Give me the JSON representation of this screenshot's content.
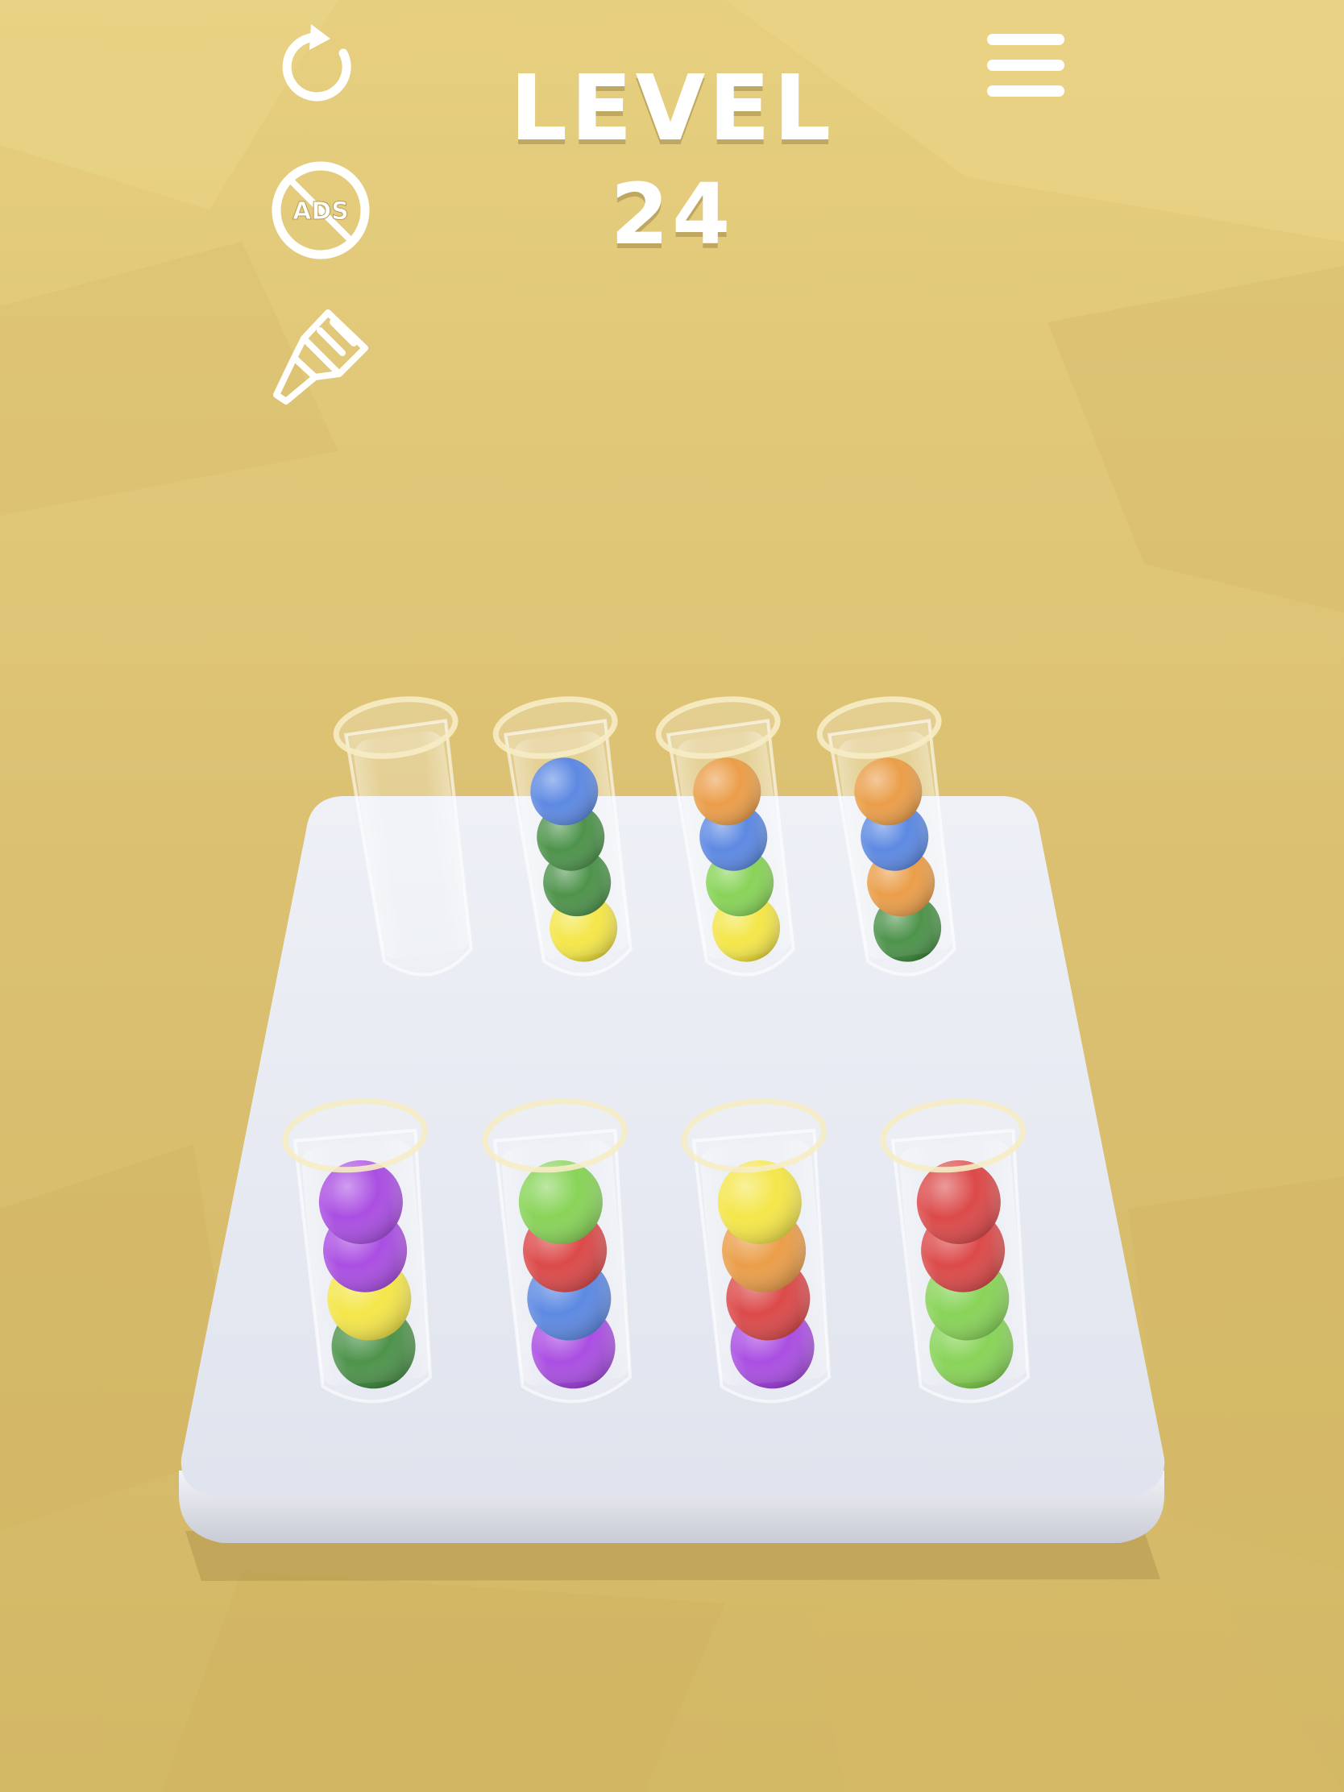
{
  "level": {
    "label": "LEVEL",
    "number": "24"
  },
  "hud": {
    "restart_icon": "restart-icon",
    "no_ads_icon": "no-ads-icon",
    "no_ads_text": "ADS",
    "paint_icon": "paintbrush-icon",
    "menu_icon": "hamburger-menu-icon"
  },
  "colors": {
    "background": "#dcc173",
    "board": "#e9ecf3",
    "blue": "#4f7fe0",
    "dark_green": "#3e8a3c",
    "light_green": "#7ed04a",
    "yellow": "#f3e43a",
    "orange": "#e9963a",
    "purple": "#a33fe0",
    "red": "#d93a3a"
  },
  "tubes": [
    {
      "row": "back",
      "balls": []
    },
    {
      "row": "back",
      "balls": [
        "blue",
        "dark_green",
        "dark_green",
        "yellow"
      ]
    },
    {
      "row": "back",
      "balls": [
        "orange",
        "blue",
        "light_green",
        "yellow"
      ]
    },
    {
      "row": "back",
      "balls": [
        "orange",
        "blue",
        "orange",
        "dark_green"
      ]
    },
    {
      "row": "front",
      "balls": [
        "purple",
        "purple",
        "yellow",
        "dark_green"
      ]
    },
    {
      "row": "front",
      "balls": [
        "light_green",
        "red",
        "blue",
        "purple"
      ]
    },
    {
      "row": "front",
      "balls": [
        "yellow",
        "orange",
        "red",
        "purple"
      ]
    },
    {
      "row": "front",
      "balls": [
        "red",
        "red",
        "light_green",
        "light_green"
      ]
    }
  ]
}
